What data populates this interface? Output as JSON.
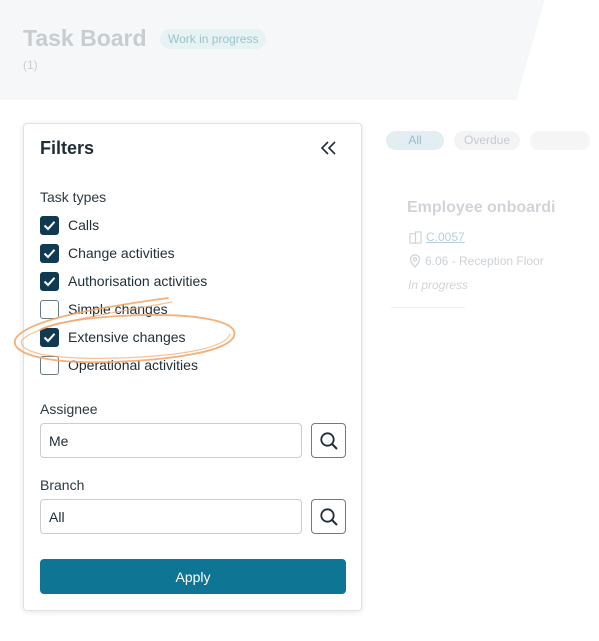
{
  "board": {
    "title": "Task Board",
    "status_badge": "Work in progress",
    "count": "(1)"
  },
  "chips": {
    "all": "All",
    "overdue": "Overdue"
  },
  "card": {
    "title": "Employee onboardi",
    "code": "C.0057",
    "location": "6.06 - Reception Floor",
    "status": "In progress"
  },
  "filters": {
    "title": "Filters",
    "collapse_icon": "double-chevron-left-icon",
    "task_types_label": "Task types",
    "task_types": [
      {
        "label": "Calls",
        "checked": true
      },
      {
        "label": "Change activities",
        "checked": true
      },
      {
        "label": "Authorisation activities",
        "checked": true
      },
      {
        "label": "Simple changes",
        "checked": false
      },
      {
        "label": "Extensive changes",
        "checked": true
      },
      {
        "label": "Operational activities",
        "checked": false
      }
    ],
    "assignee_label": "Assignee",
    "assignee_value": "Me",
    "branch_label": "Branch",
    "branch_value": "All",
    "apply_label": "Apply"
  },
  "colors": {
    "checkbox_checked": "#0f3a52",
    "apply_button": "#0f7595",
    "highlight_stroke": "#f2a86b"
  }
}
